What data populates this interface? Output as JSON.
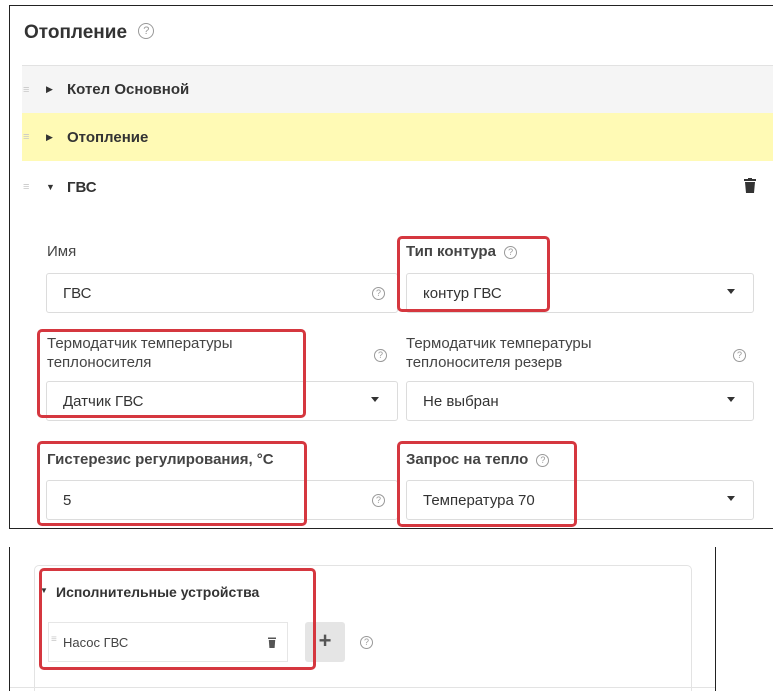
{
  "header": {
    "title": "Отопление",
    "help_icon": "help-icon"
  },
  "circuits": [
    {
      "label": "Котел Основной",
      "state": "collapsed"
    },
    {
      "label": "Отопление",
      "state": "collapsed",
      "highlight": "#fffab5"
    },
    {
      "label": "ГВС",
      "state": "expanded"
    }
  ],
  "form": {
    "name": {
      "label": "Имя",
      "value": "ГВС"
    },
    "circuit_type": {
      "label": "Тип контура",
      "value": "контур ГВС"
    },
    "sensor": {
      "label": "Термодатчик температуры теплоносителя",
      "value": "Датчик ГВС"
    },
    "sensor_reserve": {
      "label": "Термодатчик температуры теплоносителя резерв",
      "value": "Не выбран"
    },
    "hysteresis": {
      "label": "Гистерезис регулирования, °С",
      "value": "5"
    },
    "heat_request": {
      "label": "Запрос на тепло",
      "value": "Температура 70"
    }
  },
  "actuators": {
    "title": "Исполнительные устройства",
    "items": [
      {
        "label": "Насос ГВС"
      }
    ],
    "add_label": "+"
  },
  "colors": {
    "highlight_frame": "#d5373f",
    "selected_row": "#fffab5"
  }
}
